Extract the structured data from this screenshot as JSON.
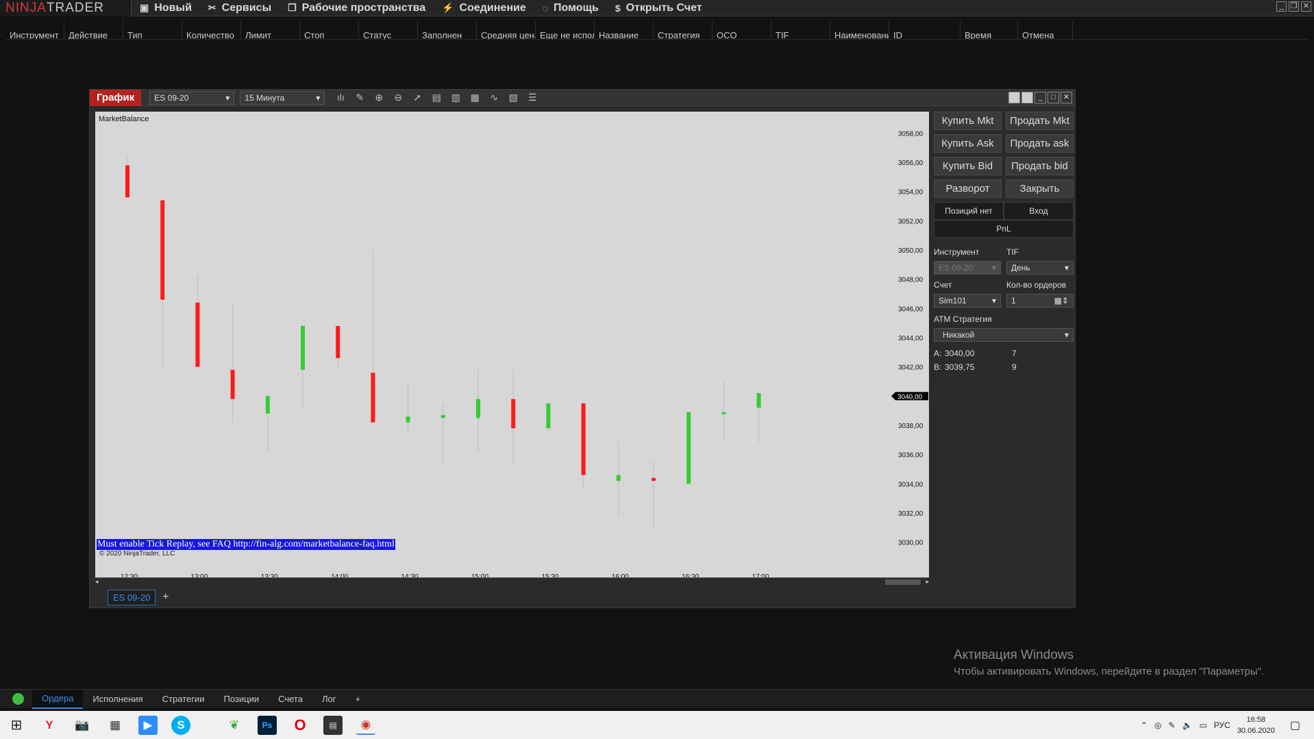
{
  "menubar": {
    "logo_a": "NINJA",
    "logo_b": "TRADER",
    "items": [
      {
        "label": "Новый",
        "icon": "new-icon"
      },
      {
        "label": "Сервисы",
        "icon": "tools-icon"
      },
      {
        "label": "Рабочие пространства",
        "icon": "workspaces-icon"
      },
      {
        "label": "Соединение",
        "icon": "connection-icon"
      },
      {
        "label": "Помощь",
        "icon": "help-icon"
      },
      {
        "label": "Открыть Счет",
        "icon": "dollar-icon"
      }
    ]
  },
  "orders": {
    "columns": [
      "Инструмент",
      "Действие",
      "Тип",
      "Количество",
      "Лимит",
      "Стоп",
      "Статус",
      "Заполнен",
      "Средняя цена",
      "Еще не исполнен",
      "Название",
      "Стратегия",
      "OCO",
      "TIF",
      "Наименование с",
      "ID",
      "Время",
      "Отмена"
    ]
  },
  "chart_window": {
    "title": "График",
    "instrument": "ES 09-20",
    "interval": "15 Минута",
    "indicator_label": "MarketBalance",
    "warning": "Must enable Tick Replay, see FAQ http://fin-alg.com/marketbalance-faq.html",
    "copyright": "© 2020 NinjaTrader, LLC",
    "tab": "ES 09-20",
    "tab_add": "+"
  },
  "chart_data": {
    "type": "candlestick",
    "y_ticks": [
      "3058,00",
      "3056,00",
      "3054,00",
      "3052,00",
      "3050,00",
      "3048,00",
      "3046,00",
      "3044,00",
      "3042,00",
      "3040,00",
      "3038,00",
      "3036,00",
      "3034,00",
      "3032,00",
      "3030,00"
    ],
    "x_ticks": [
      "12:30",
      "13:00",
      "13:30",
      "14:00",
      "14:30",
      "15:00",
      "15:30",
      "16:00",
      "16:30",
      "17:00"
    ],
    "ylim": [
      3029,
      3059
    ],
    "last_price": "3040,00",
    "candles": [
      {
        "t": "12:30",
        "open": 3055.8,
        "close": 3053.6,
        "high": 3056.5,
        "low": 3053.6,
        "dir": "down"
      },
      {
        "t": "12:45",
        "open": 3053.4,
        "close": 3046.6,
        "high": 3053.4,
        "low": 3042.0,
        "dir": "down"
      },
      {
        "t": "13:00",
        "open": 3046.4,
        "close": 3042.0,
        "high": 3048.2,
        "low": 3042.0,
        "dir": "down"
      },
      {
        "t": "13:15",
        "open": 3041.8,
        "close": 3039.8,
        "high": 3046.4,
        "low": 3038.2,
        "dir": "down"
      },
      {
        "t": "13:30",
        "open": 3038.8,
        "close": 3040.0,
        "high": 3040.2,
        "low": 3036.2,
        "dir": "up"
      },
      {
        "t": "13:45",
        "open": 3041.8,
        "close": 3044.8,
        "high": 3044.8,
        "low": 3039.2,
        "dir": "up"
      },
      {
        "t": "14:00",
        "open": 3044.8,
        "close": 3042.6,
        "high": 3044.8,
        "low": 3041.8,
        "dir": "down"
      },
      {
        "t": "14:15",
        "open": 3041.6,
        "close": 3038.2,
        "high": 3050.0,
        "low": 3038.2,
        "dir": "down"
      },
      {
        "t": "14:30",
        "open": 3038.2,
        "close": 3038.6,
        "high": 3041.0,
        "low": 3037.4,
        "dir": "up"
      },
      {
        "t": "14:45",
        "open": 3038.5,
        "close": 3038.7,
        "high": 3039.5,
        "low": 3035.2,
        "dir": "up"
      },
      {
        "t": "15:00",
        "open": 3038.5,
        "close": 3039.8,
        "high": 3041.8,
        "low": 3036.2,
        "dir": "up"
      },
      {
        "t": "15:15",
        "open": 3039.8,
        "close": 3037.8,
        "high": 3041.8,
        "low": 3035.4,
        "dir": "down"
      },
      {
        "t": "15:30",
        "open": 3037.8,
        "close": 3039.5,
        "high": 3039.6,
        "low": 3037.4,
        "dir": "up"
      },
      {
        "t": "15:45",
        "open": 3039.5,
        "close": 3034.6,
        "high": 3039.6,
        "low": 3033.6,
        "dir": "down"
      },
      {
        "t": "16:00",
        "open": 3034.2,
        "close": 3034.6,
        "high": 3036.8,
        "low": 3031.8,
        "dir": "up"
      },
      {
        "t": "16:15",
        "open": 3034.4,
        "close": 3034.2,
        "high": 3035.6,
        "low": 3030.8,
        "dir": "down"
      },
      {
        "t": "16:30",
        "open": 3034.0,
        "close": 3038.9,
        "high": 3038.9,
        "low": 3034.0,
        "dir": "up"
      },
      {
        "t": "16:45",
        "open": 3038.8,
        "close": 3038.9,
        "high": 3041.0,
        "low": 3037.0,
        "dir": "up"
      },
      {
        "t": "17:00",
        "open": 3039.2,
        "close": 3040.2,
        "high": 3040.4,
        "low": 3036.8,
        "dir": "up"
      }
    ],
    "colors": {
      "up": "#32cd32",
      "down": "#ff1a1a",
      "wick": "#bdbdbd"
    }
  },
  "order_panel": {
    "buy_mkt": "Купить Mkt",
    "sell_mkt": "Продать Mkt",
    "buy_ask": "Купить Ask",
    "sell_ask": "Продать ask",
    "buy_bid": "Купить Bid",
    "sell_bid": "Продать bid",
    "reverse": "Разворот",
    "close": "Закрыть",
    "position": "Позиций нет",
    "entry": "Вход",
    "pnl": "PnL",
    "instrument_label": "Инструмент",
    "instrument_value": "ES 09-20",
    "tif_label": "TIF",
    "tif_value": "День",
    "account_label": "Счет",
    "account_value": "Sim101",
    "qty_label": "Кол-во ордеров",
    "qty_value": "1",
    "atm_label": "ATM Стратегия",
    "atm_value": "Никакой",
    "ask_label": "A:",
    "ask_price": "3040,00",
    "ask_size": "7",
    "bid_label": "B:",
    "bid_price": "3039,75",
    "bid_size": "9"
  },
  "activation": {
    "line1": "Активация Windows",
    "line2": "Чтобы активировать Windows, перейдите в раздел \"Параметры\"."
  },
  "status_tabs": [
    "Ордера",
    "Исполнения",
    "Стратегии",
    "Позиции",
    "Счета",
    "Лог"
  ],
  "status_add": "+",
  "taskbar": {
    "lang": "РУС",
    "time": "16:58",
    "date": "30.06.2020"
  }
}
